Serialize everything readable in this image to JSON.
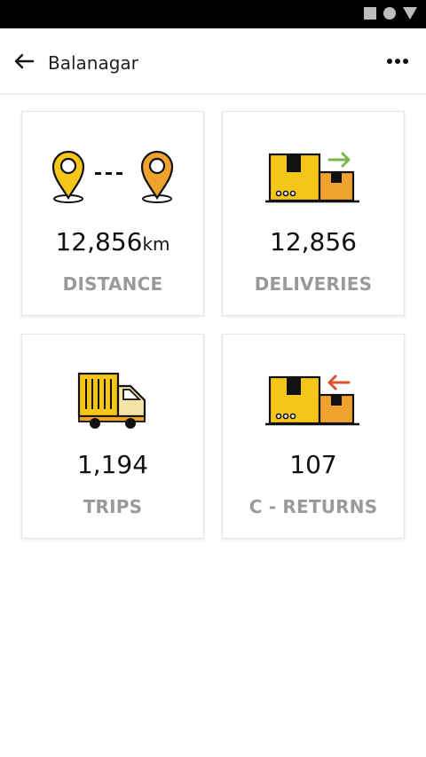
{
  "header": {
    "title": "Balanagar"
  },
  "cards": [
    {
      "value": "12,856",
      "unit": "km",
      "label": "DISTANCE"
    },
    {
      "value": "12,856",
      "label": "DELIVERIES"
    },
    {
      "value": "1,194",
      "label": "TRIPS"
    },
    {
      "value": "107",
      "label": "C - RETURNS"
    }
  ],
  "colors": {
    "accent_yellow": "#F5C518",
    "accent_orange": "#F0A22E",
    "arrow_green": "#7AB648",
    "arrow_red": "#D9542B",
    "label_gray": "#9A9A9A"
  }
}
